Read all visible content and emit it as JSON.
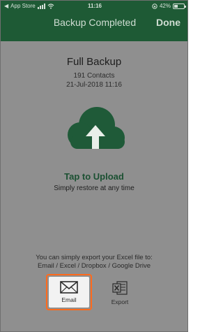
{
  "status_bar": {
    "carrier": "App Store",
    "time": "11:16",
    "battery": "42%",
    "battery_level": 0.42
  },
  "nav": {
    "title": "Backup Completed",
    "done_label": "Done"
  },
  "summary": {
    "title": "Full Backup",
    "contacts": "191 Contacts",
    "date": "21-Jul-2018 11:16"
  },
  "upload": {
    "icon": "cloud-upload-icon",
    "label": "Tap to Upload",
    "subtitle": "Simply restore at any time"
  },
  "export_info": {
    "line1": "You can simply export your Excel file to:",
    "line2": "Email / Excel / Dropbox / Google Drive"
  },
  "actions": [
    {
      "label": "Email",
      "icon": "envelope-icon"
    },
    {
      "label": "Export",
      "icon": "excel-icon"
    }
  ],
  "colors": {
    "header": "#1e5a35",
    "cloud": "#1f5a38",
    "overlay": "#8f8f8f",
    "highlight": "#ff6a1c"
  }
}
